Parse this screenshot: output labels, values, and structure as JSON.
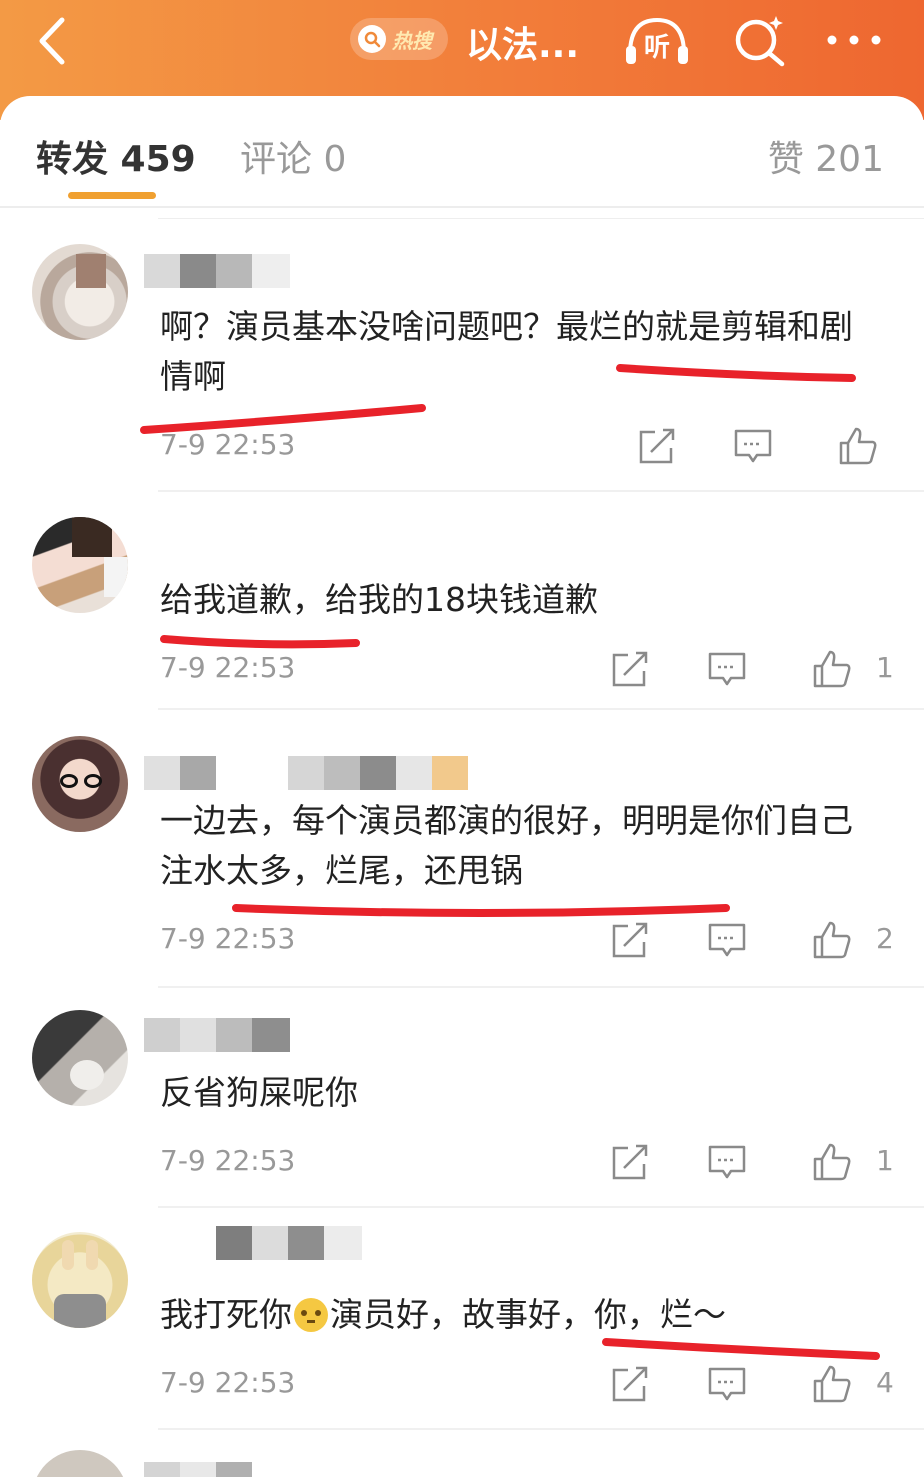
{
  "header": {
    "hot_badge": "热搜",
    "title": "以法...",
    "listen_label": "听"
  },
  "tabs": {
    "repost": "转发 459",
    "comment": "评论 0",
    "like": "赞 201"
  },
  "comments": [
    {
      "text": "啊？演员基本没啥问题吧？最烂的就是剪辑和剧情啊",
      "time": "7-9 22:53",
      "likes": ""
    },
    {
      "text": "给我道歉，给我的18块钱道歉",
      "time": "7-9 22:53",
      "likes": "1"
    },
    {
      "text": "一边去，每个演员都演的很好，明明是你们自己注水太多，烂尾，还甩锅",
      "time": "7-9 22:53",
      "likes": "2"
    },
    {
      "text": "反省狗屎呢你",
      "time": "7-9 22:53",
      "likes": "1"
    },
    {
      "text_a": "我打死你",
      "text_b": "演员好，故事好，你，烂～",
      "time": "7-9 22:53",
      "likes": "4"
    }
  ],
  "colors": {
    "header_orange": "#f27d3a",
    "tab_underline": "#f0a030",
    "annotation_red": "#e8222a"
  },
  "icons": [
    "back-arrow-icon",
    "search-icon",
    "headphones-icon",
    "more-icon",
    "share-icon",
    "comment-icon",
    "thumbs-up-icon"
  ]
}
